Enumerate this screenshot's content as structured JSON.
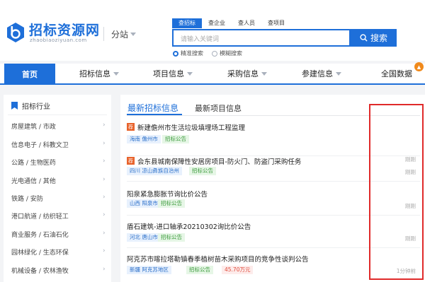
{
  "header": {
    "logo_title": "招标资源网",
    "logo_domain": "zhaobiaoziyuan.com",
    "substation_label": "分站"
  },
  "search": {
    "tabs": [
      "查招标",
      "查企业",
      "查人员",
      "查项目"
    ],
    "active_tab": 0,
    "placeholder": "请输入关键词",
    "button_label": "搜索",
    "modes": [
      "精准搜索",
      "模糊搜索"
    ],
    "selected_mode": 0
  },
  "nav": {
    "items": [
      {
        "label": "首页",
        "dropdown": false
      },
      {
        "label": "招标信息",
        "dropdown": true
      },
      {
        "label": "项目信息",
        "dropdown": true
      },
      {
        "label": "采购信息",
        "dropdown": true
      },
      {
        "label": "参建信息",
        "dropdown": true
      },
      {
        "label": "全国数据",
        "dropdown": false
      }
    ],
    "active": 0
  },
  "sidebar": {
    "title": "招标行业",
    "categories": [
      "房屋建筑 / 市政",
      "信息电子 / 科教文卫",
      "公路 / 生物医药",
      "光电通信 / 其他",
      "铁路 / 安防",
      "港口航道 / 纺织轻工",
      "商业服务 / 石油石化",
      "园林绿化 / 生态环保",
      "机械设备 / 农林渔牧"
    ]
  },
  "main": {
    "tabs": [
      "最新招标信息",
      "最新项目信息"
    ],
    "active_tab": 0,
    "recommend_badge": "荐",
    "items": [
      {
        "recommended": true,
        "title": "新建儋州市生活垃圾填埋场工程监理",
        "region": "海南 儋州市",
        "type": "招标公告",
        "amount": "",
        "time": "刚刚"
      },
      {
        "recommended": true,
        "title": "会东县城南保障性安居房项目-防火门、防盗门采购任务",
        "region": "四川 凉山彝族自治州",
        "type": "招标公告",
        "amount": "",
        "time": "刚刚"
      },
      {
        "recommended": false,
        "title": "阳泉紧急膨胀节询比价公告",
        "region": "山西 阳泉市",
        "type": "招标公告",
        "amount": "",
        "time": "刚刚"
      },
      {
        "recommended": false,
        "title": "盾石建筑-进口轴承20210302询比价公告",
        "region": "河北 唐山市",
        "type": "招标公告",
        "amount": "",
        "time": "刚刚"
      },
      {
        "recommended": false,
        "title": "阿克苏市喀拉塔勒镇春季植树苗木采购项目的竞争性谈判公告",
        "region": "新疆 阿克苏地区",
        "type": "招标公告",
        "amount": "45.70万元",
        "time": "1分钟前"
      }
    ]
  },
  "colors": {
    "brand_blue": "#1e6fd9",
    "recommend_orange": "#e8632c",
    "highlight_red": "#e02a2a",
    "tag_green": "#3a9a3a"
  },
  "icons": {
    "logo": "b-logo-icon",
    "search": "search-icon",
    "sidebar_head": "bookmark-icon",
    "hot": "fire-icon"
  }
}
